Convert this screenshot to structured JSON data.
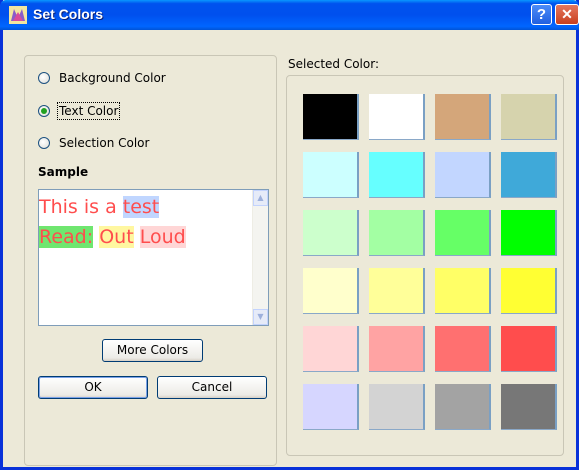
{
  "window": {
    "title": "Set Colors",
    "help_label": "?",
    "close_label": "✕"
  },
  "color_target": {
    "options": [
      {
        "label": "Background Color",
        "checked": false
      },
      {
        "label": "Text Color",
        "checked": true
      },
      {
        "label": "Selection Color",
        "checked": false
      }
    ]
  },
  "sample": {
    "label": "Sample",
    "line1_a": "This is a ",
    "line1_b": "test",
    "line2_a": "Read:",
    "line2_b": "Out",
    "line2_c": "Loud"
  },
  "buttons": {
    "more_colors": "More Colors",
    "ok": "OK",
    "cancel": "Cancel"
  },
  "palette": {
    "label": "Selected Color:",
    "colors": [
      "#000000",
      "#ffffff",
      "#d4a67a",
      "#d6d3ad",
      "#ccffff",
      "#66ffff",
      "#c2d6ff",
      "#3fa9d9",
      "#ccffcc",
      "#a3ffa3",
      "#66ff66",
      "#00ff00",
      "#ffffcc",
      "#ffff99",
      "#ffff66",
      "#ffff33",
      "#ffd6d6",
      "#ffa3a3",
      "#ff7070",
      "#ff4d4d",
      "#d6d6ff",
      "#d3d3d3",
      "#a3a3a3",
      "#777777"
    ]
  }
}
